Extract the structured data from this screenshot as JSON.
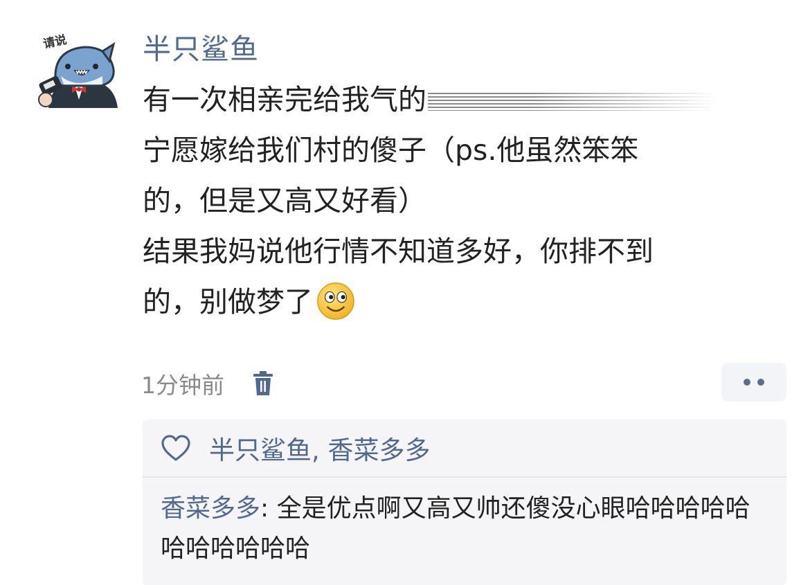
{
  "comment": {
    "avatar": {
      "icon": "shark-reporter-icon",
      "caption": "请说"
    },
    "username": "半只鲨鱼",
    "lines": [
      "有一次相亲完给我气的",
      "宁愿嫁给我们村的傻子（ps.他虽然笨笨",
      "的，但是又高又好看）",
      "结果我妈说他行情不知道多好，你排不到",
      "的，别做梦了"
    ],
    "emoji": "smiley-emoji-icon",
    "timestamp": "1分钟前",
    "delete_icon": "trash-icon",
    "more_icon": "more-dots-icon"
  },
  "reply_box": {
    "heart_icon": "heart-icon",
    "likes": "半只鲨鱼, 香菜多多",
    "reply": {
      "author": "香菜多多",
      "separator": ": ",
      "text": "全是优点啊又高又帅还傻没心眼哈哈哈哈哈哈哈哈哈哈哈"
    }
  },
  "colors": {
    "username": "#4f6a93",
    "link_blue": "#51698f",
    "timestamp": "#8a8a8a",
    "reply_bg": "#f5f5f7"
  }
}
